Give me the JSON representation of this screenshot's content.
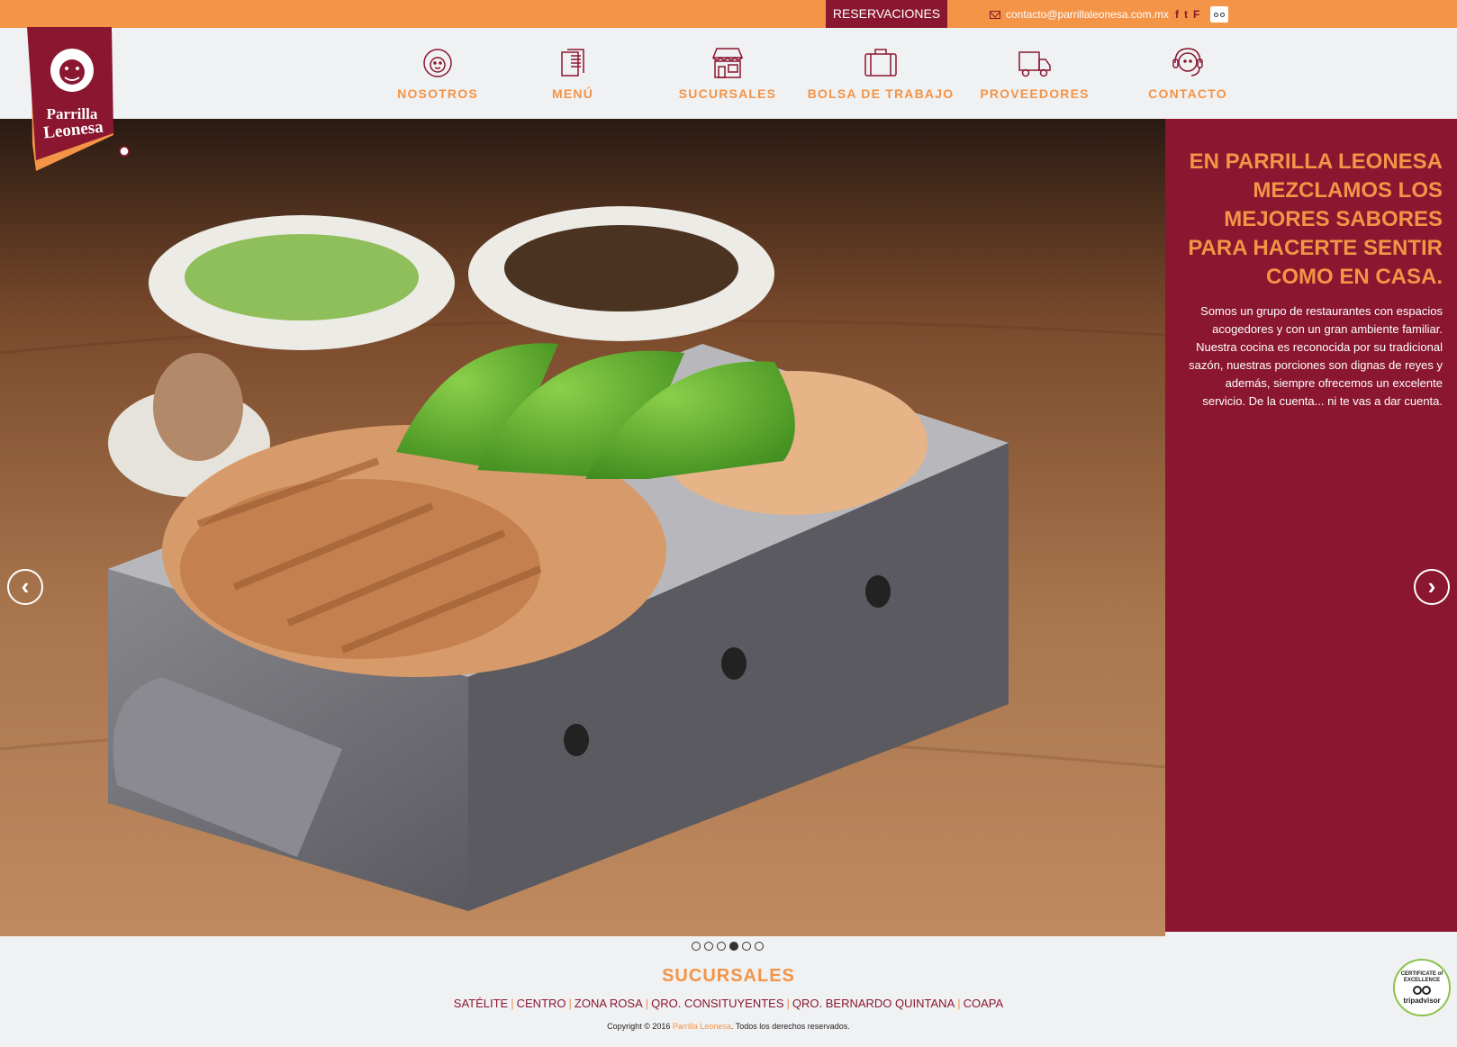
{
  "topbar": {
    "reservations_label": "RESERVACIONES",
    "email": "contacto@parrillaleonesa.com.mx",
    "social": [
      "f",
      "t",
      "F"
    ]
  },
  "logo": {
    "line1": "Parrilla",
    "line2": "Leonesa"
  },
  "nav": [
    {
      "label": "NOSOTROS",
      "icon": "lion-icon"
    },
    {
      "label": "MENÚ",
      "icon": "menu-icon"
    },
    {
      "label": "SUCURSALES",
      "icon": "store-icon"
    },
    {
      "label": "BOLSA DE TRABAJO",
      "icon": "briefcase-icon"
    },
    {
      "label": "PROVEEDORES",
      "icon": "truck-icon"
    },
    {
      "label": "CONTACTO",
      "icon": "headset-icon"
    }
  ],
  "hero": {
    "heading": "EN PARRILLA LEONESA MEZCLAMOS LOS MEJORES SABORES PARA HACERTE SENTIR COMO EN CASA.",
    "body": "Somos un grupo de restaurantes con espacios acogedores y con un gran ambiente familiar. Nuestra cocina es reconocida por su tradicional sazón, nuestras porciones son dignas de reyes y además, siempre ofrecemos un excelente servicio. De la cuenta... ni te vas a dar cuenta.",
    "prev": "‹",
    "next": "›",
    "slide_count": 6,
    "active_slide": 4
  },
  "footer": {
    "title": "SUCURSALES",
    "branches": [
      "SATÉLITE",
      "CENTRO",
      "ZONA ROSA",
      "QRO. CONSITUYENTES",
      "QRO. BERNARDO QUINTANA",
      "COAPA"
    ],
    "copyright_pre": "Copyright © 2016",
    "copyright_brand": "Parrilla Leonesa",
    "copyright_post": ". Todos los derechos reservados.",
    "cert_line1": "CERTIFICATE of EXCELLENCE",
    "cert_brand": "tripadvisor"
  },
  "colors": {
    "orange": "#f39447",
    "burgundy": "#8a1630",
    "background": "#f0f1f3"
  }
}
